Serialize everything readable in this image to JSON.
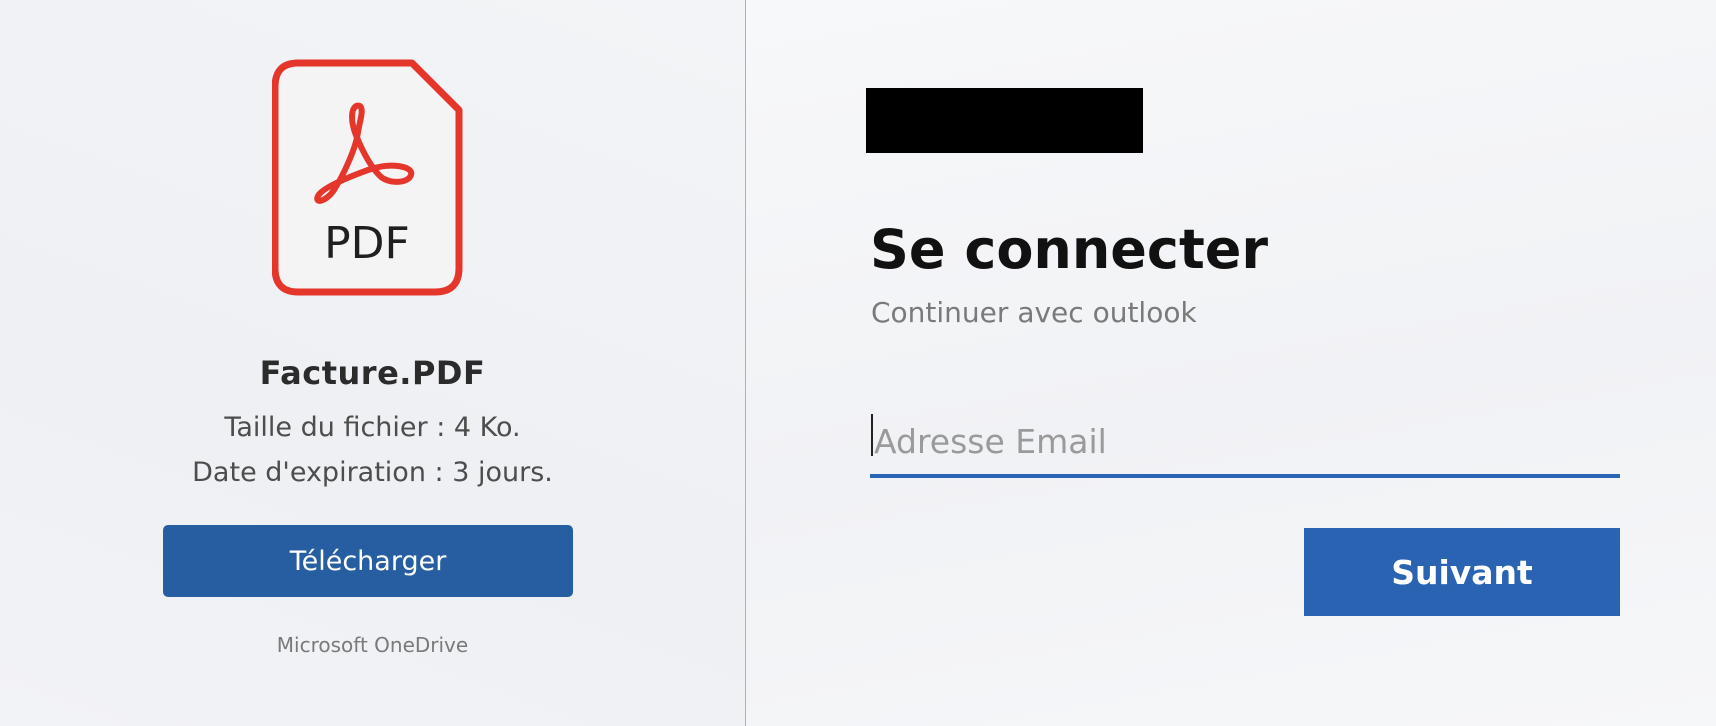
{
  "file_card": {
    "icon": "pdf-file-icon",
    "icon_label": "PDF",
    "file_name": "Facture.PDF",
    "file_size": "Taille du fichier : 4 Ko.",
    "expiry": "Date d'expiration : 3 jours.",
    "download_label": "Télécharger",
    "brand": "Microsoft OneDrive"
  },
  "signin": {
    "title": "Se connecter",
    "subtitle": "Continuer avec outlook",
    "email_placeholder": "Adresse Email",
    "email_value": "",
    "next_label": "Suivant"
  },
  "colors": {
    "pdf_red": "#e4362a",
    "button_blue": "#275ea2",
    "next_blue": "#2a63b2",
    "underline_blue": "#2a64b4",
    "redaction": "#000000"
  }
}
